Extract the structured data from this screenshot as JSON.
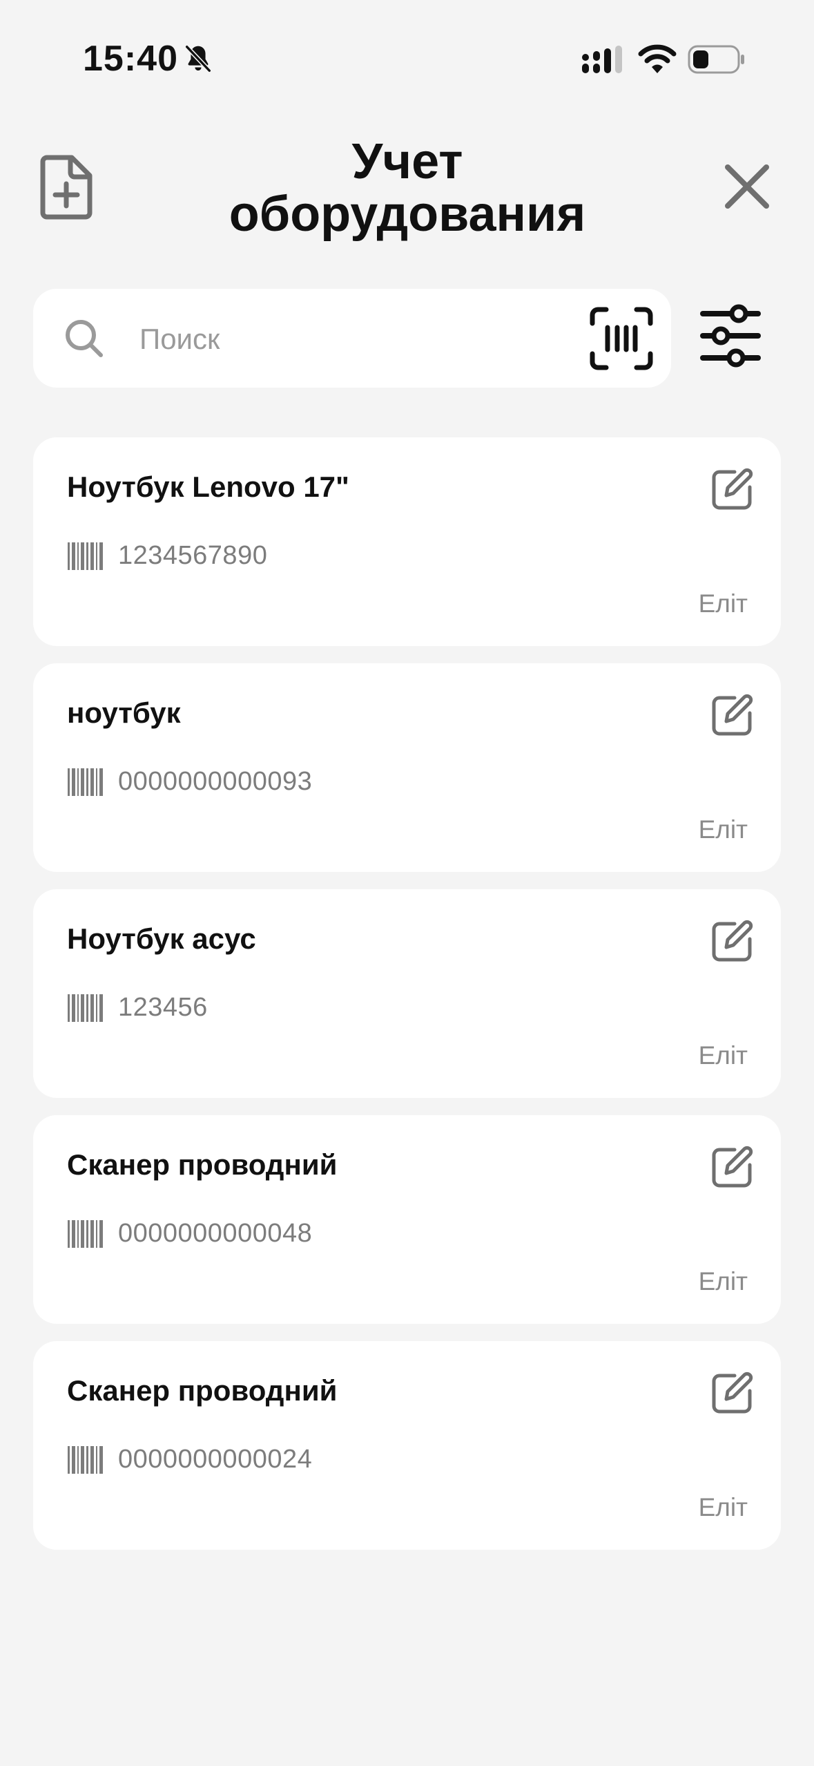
{
  "status_bar": {
    "time": "15:40"
  },
  "header": {
    "title_line1": "Учет",
    "title_line2": "оборудования"
  },
  "search": {
    "placeholder": "Поиск",
    "value": ""
  },
  "items": [
    {
      "title": "Ноутбук Lenovo 17\"",
      "code": "1234567890",
      "owner": "Еліт"
    },
    {
      "title": "ноутбук",
      "code": "0000000000093",
      "owner": "Еліт"
    },
    {
      "title": "Ноутбук асус",
      "code": "123456",
      "owner": "Еліт"
    },
    {
      "title": "Сканер проводний",
      "code": "0000000000048",
      "owner": "Еліт"
    },
    {
      "title": "Сканер проводний",
      "code": "0000000000024",
      "owner": "Еліт"
    }
  ],
  "icons": {
    "status": [
      "bell-off-icon",
      "signal-icon",
      "wifi-icon",
      "battery-icon"
    ],
    "header": [
      "add-document-icon",
      "close-icon"
    ],
    "search": [
      "search-icon",
      "barcode-scan-icon",
      "filter-sliders-icon"
    ],
    "card": [
      "edit-icon",
      "barcode-icon"
    ]
  },
  "colors": {
    "background": "#f4f4f4",
    "card": "#ffffff",
    "text": "#111111",
    "muted": "#7c7c7c",
    "icon": "#6f6f6f"
  }
}
